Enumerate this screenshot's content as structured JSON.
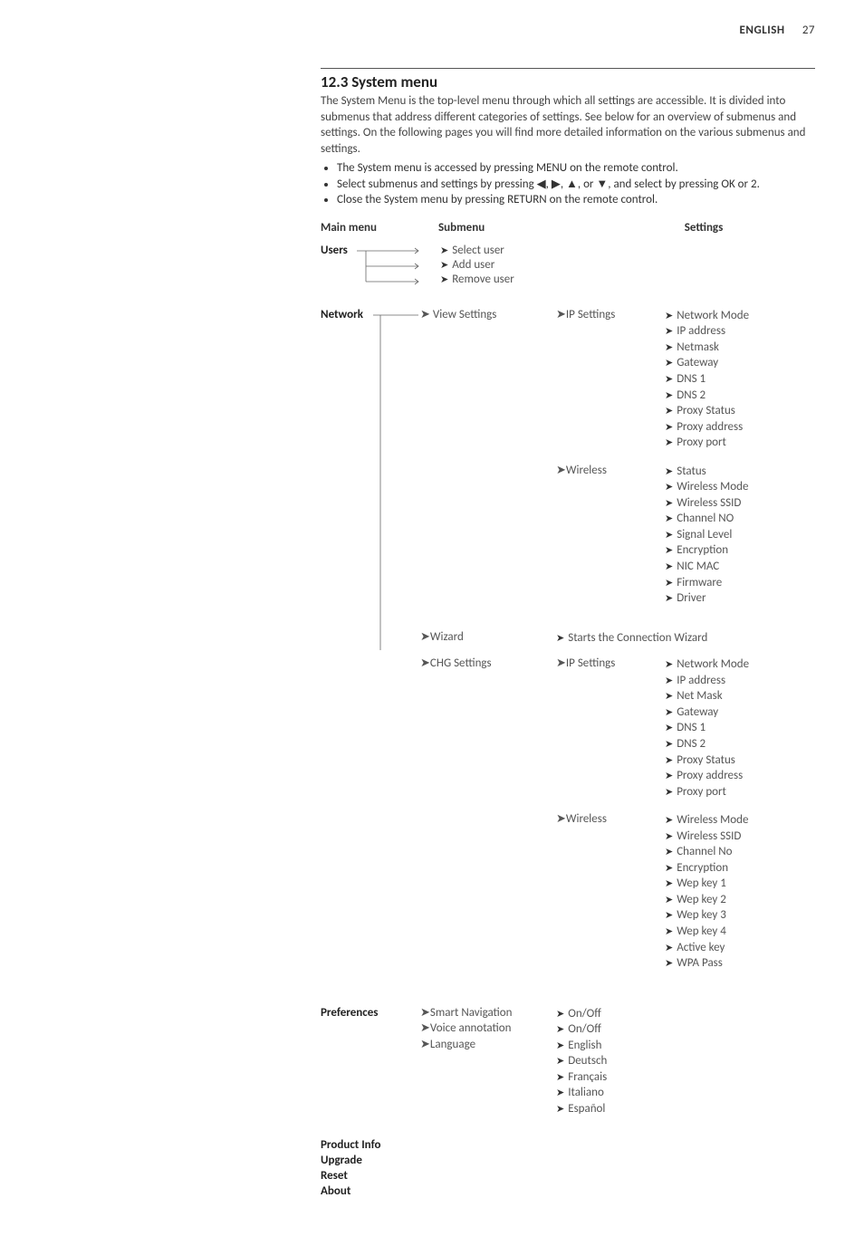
{
  "header": {
    "language": "ENGLISH",
    "page_number": "27"
  },
  "section": {
    "title": "12.3 System menu",
    "intro": "The System Menu is the top-level menu through which all settings are accessible. It is divided into submenus that address different categories of settings. See below for an overview of submenus and settings. On the following pages you will find more detailed information on the various submenus and settings.",
    "bullets": [
      "The System menu is accessed by pressing MENU on the remote control.",
      "Select submenus and settings by pressing ◀, ▶, ▲, or ▼, and select by pressing OK or 2.",
      "Close the System menu by pressing RETURN on the remote control."
    ]
  },
  "columns": {
    "main": "Main menu",
    "submenu": "Submenu",
    "settings": "Settings"
  },
  "menu": {
    "users": {
      "label": "Users",
      "items": [
        "Select user",
        "Add user",
        "Remove user"
      ]
    },
    "network": {
      "label": "Network",
      "view": {
        "label": "View Settings",
        "ip": {
          "label": "IP Settings",
          "opts": [
            "Network Mode",
            "IP address",
            "Netmask",
            "Gateway",
            "DNS 1",
            "DNS 2",
            "Proxy Status",
            "Proxy address",
            "Proxy port"
          ]
        },
        "wireless": {
          "label": "Wireless",
          "opts": [
            "Status",
            "Wireless Mode",
            "Wireless SSID",
            "Channel NO",
            "Signal Level",
            "Encryption",
            "NIC MAC",
            "Firmware",
            "Driver"
          ]
        }
      },
      "wizard": {
        "label": "Wizard",
        "desc": "Starts the Connection Wizard"
      },
      "chg": {
        "label": "CHG Settings",
        "ip": {
          "label": "IP Settings",
          "opts": [
            "Network Mode",
            "IP address",
            "Net Mask",
            "Gateway",
            "DNS 1",
            "DNS 2",
            "Proxy Status",
            "Proxy address",
            "Proxy port"
          ]
        },
        "wireless": {
          "label": "Wireless",
          "opts": [
            "Wireless Mode",
            "Wireless SSID",
            "Channel No",
            "Encryption",
            "Wep key 1",
            "Wep key 2",
            "Wep key 3",
            "Wep key 4",
            "Active key",
            "WPA Pass"
          ]
        }
      }
    },
    "prefs": {
      "label": "Preferences",
      "smart": {
        "label": "Smart Navigation",
        "opts": [
          "On/Off"
        ]
      },
      "voice": {
        "label": "Voice annotation",
        "opts": [
          "On/Off"
        ]
      },
      "lang": {
        "label": "Language",
        "opts": [
          "English",
          "Deutsch",
          "Français",
          "Italiano",
          "Español"
        ]
      }
    },
    "rest": [
      "Product Info",
      "Upgrade",
      "Reset",
      "About"
    ]
  }
}
